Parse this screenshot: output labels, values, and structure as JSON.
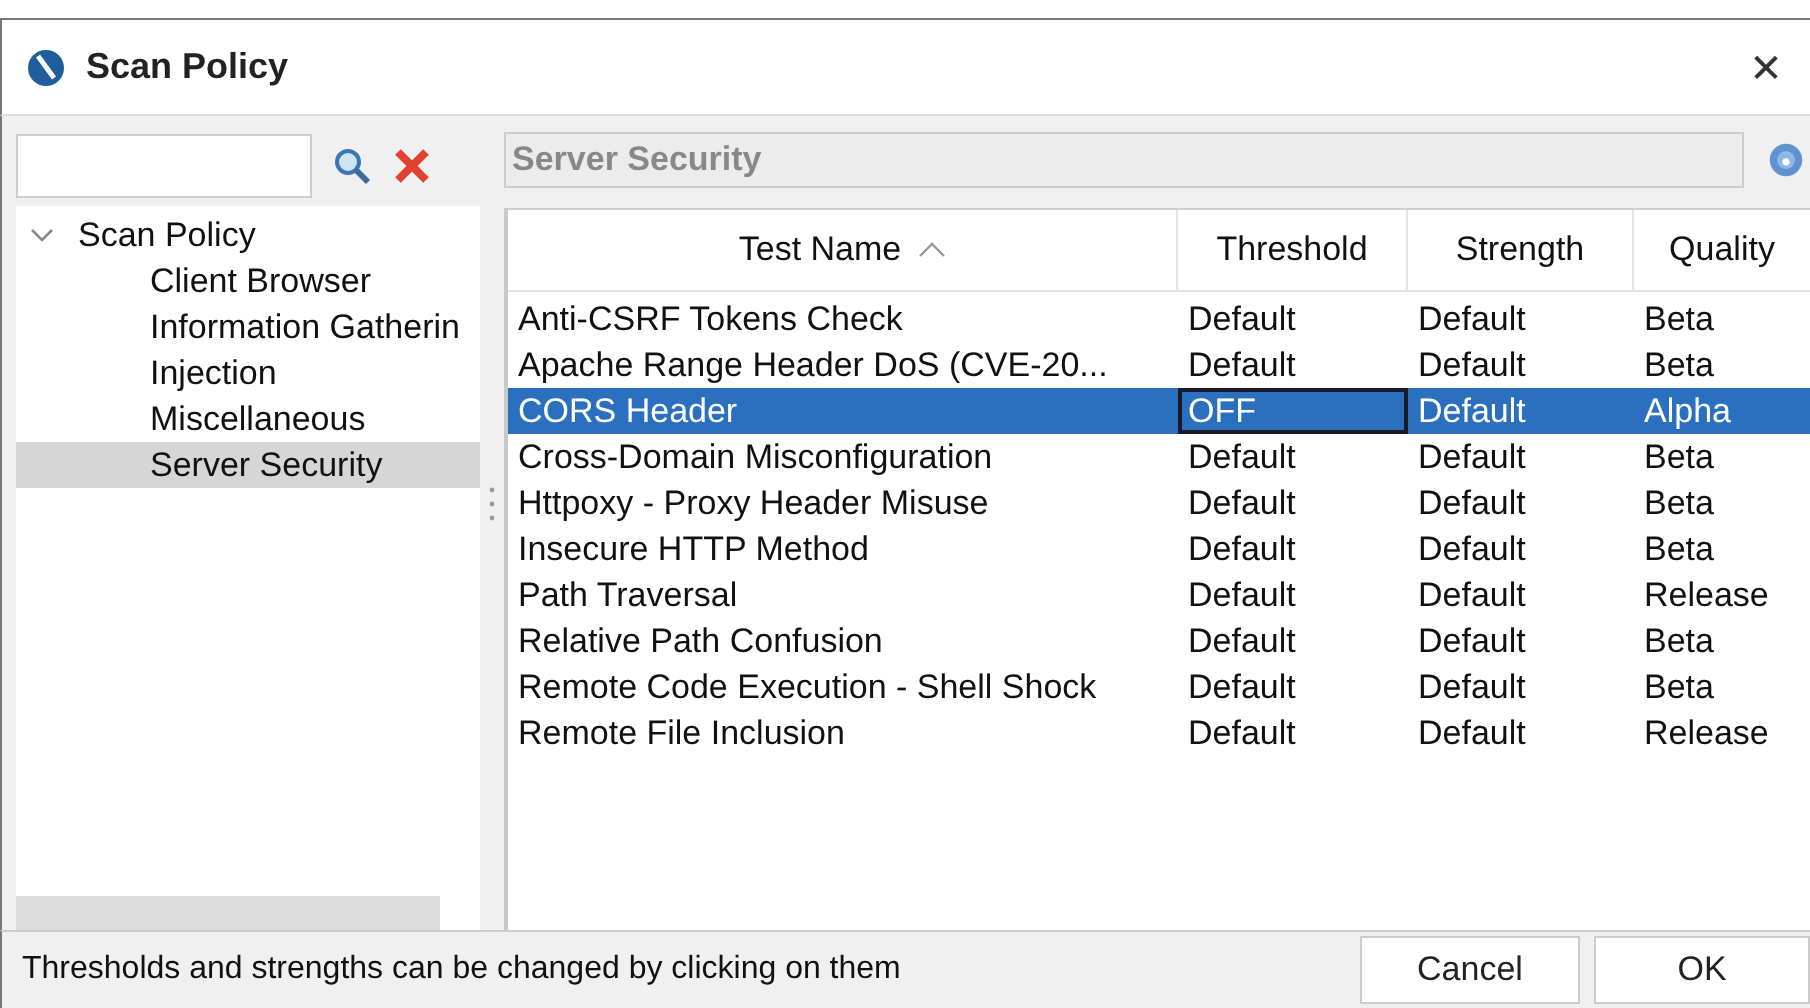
{
  "window": {
    "title": "Scan Policy",
    "close": "✕"
  },
  "tree": [
    {
      "label": "Scan Policy",
      "expanded": true,
      "selected": false,
      "children": [
        {
          "label": "Client Browser",
          "selected": false
        },
        {
          "label": "Information Gatherin",
          "selected": false
        },
        {
          "label": "Injection",
          "selected": false
        },
        {
          "label": "Miscellaneous",
          "selected": false
        },
        {
          "label": "Server Security",
          "selected": true
        }
      ]
    }
  ],
  "category_field": {
    "value": "Server Security"
  },
  "table": {
    "columns": [
      {
        "label": "Test Name",
        "sorted": true
      },
      {
        "label": "Threshold",
        "sorted": false
      },
      {
        "label": "Strength",
        "sorted": false
      },
      {
        "label": "Quality",
        "sorted": false
      }
    ],
    "rows": [
      {
        "name": "Anti-CSRF Tokens Check",
        "threshold": "Default",
        "strength": "Default",
        "quality": "Beta",
        "selected": false,
        "threshold_focused": false
      },
      {
        "name": "Apache Range Header DoS (CVE-20...",
        "threshold": "Default",
        "strength": "Default",
        "quality": "Beta",
        "selected": false,
        "threshold_focused": false
      },
      {
        "name": "CORS Header",
        "threshold": "OFF",
        "strength": "Default",
        "quality": "Alpha",
        "selected": true,
        "threshold_focused": true
      },
      {
        "name": "Cross-Domain Misconfiguration",
        "threshold": "Default",
        "strength": "Default",
        "quality": "Beta",
        "selected": false,
        "threshold_focused": false
      },
      {
        "name": "Httpoxy - Proxy Header Misuse",
        "threshold": "Default",
        "strength": "Default",
        "quality": "Beta",
        "selected": false,
        "threshold_focused": false
      },
      {
        "name": "Insecure HTTP Method",
        "threshold": "Default",
        "strength": "Default",
        "quality": "Beta",
        "selected": false,
        "threshold_focused": false
      },
      {
        "name": "Path Traversal",
        "threshold": "Default",
        "strength": "Default",
        "quality": "Release",
        "selected": false,
        "threshold_focused": false
      },
      {
        "name": "Relative Path Confusion",
        "threshold": "Default",
        "strength": "Default",
        "quality": "Beta",
        "selected": false,
        "threshold_focused": false
      },
      {
        "name": "Remote Code Execution - Shell Shock",
        "threshold": "Default",
        "strength": "Default",
        "quality": "Beta",
        "selected": false,
        "threshold_focused": false
      },
      {
        "name": "Remote File Inclusion",
        "threshold": "Default",
        "strength": "Default",
        "quality": "Release",
        "selected": false,
        "threshold_focused": false
      }
    ]
  },
  "status_bar": "Thresholds and strengths can be changed by clicking on them",
  "buttons": [
    "Cancel",
    "OK"
  ]
}
